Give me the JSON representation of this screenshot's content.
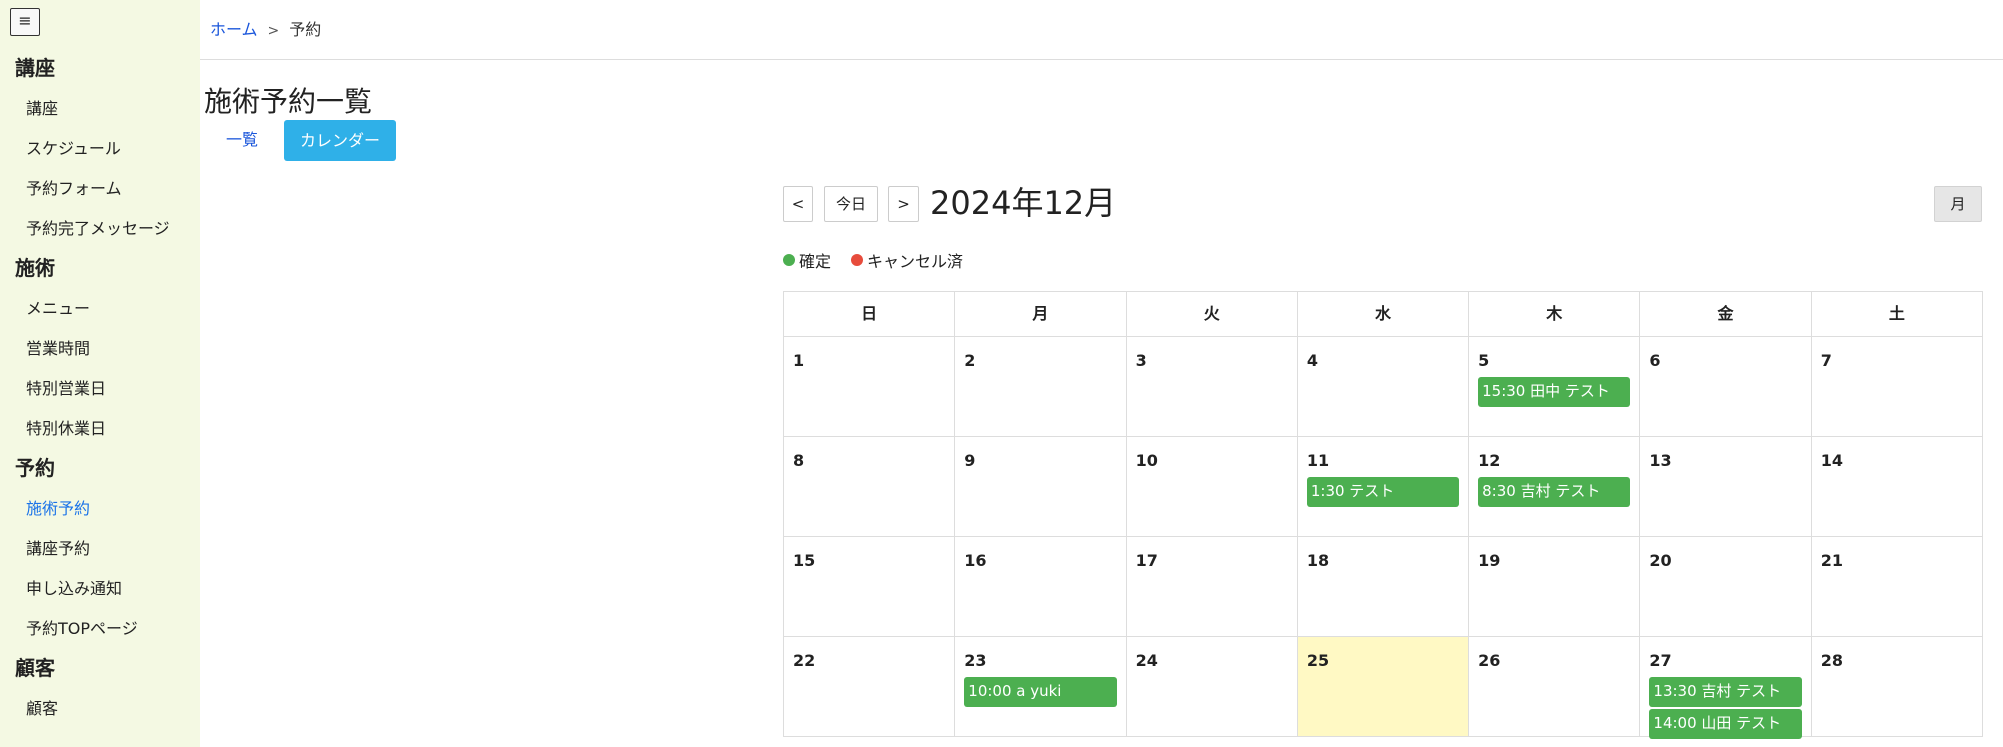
{
  "menu_toggle": "≡",
  "sidebar": {
    "groups": [
      {
        "label": "講座",
        "items": [
          "講座",
          "スケジュール",
          "予約フォーム",
          "予約完了メッセージ"
        ]
      },
      {
        "label": "施術",
        "items": [
          "メニュー",
          "営業時間",
          "特別営業日",
          "特別休業日"
        ]
      },
      {
        "label": "予約",
        "items": [
          "施術予約",
          "講座予約",
          "申し込み通知",
          "予約TOPページ"
        ]
      },
      {
        "label": "顧客",
        "items": [
          "顧客"
        ]
      }
    ],
    "active_item": "施術予約"
  },
  "breadcrumb": {
    "home": "ホーム",
    "separator": ">",
    "current": "予約"
  },
  "page_title": "施術予約一覧",
  "tabs": {
    "list": "一覧",
    "calendar": "カレンダー"
  },
  "calendar": {
    "prev": "<",
    "today": "今日",
    "next": ">",
    "title": "2024年12月",
    "view_month": "月",
    "legend": [
      {
        "label": "確定",
        "color": "#4caf50"
      },
      {
        "label": "キャンセル済",
        "color": "#e74c3c"
      }
    ],
    "weekdays": [
      "日",
      "月",
      "火",
      "水",
      "木",
      "金",
      "土"
    ],
    "today_date": 25,
    "weeks": [
      [
        {
          "day": "1",
          "events": []
        },
        {
          "day": "2",
          "events": []
        },
        {
          "day": "3",
          "events": []
        },
        {
          "day": "4",
          "events": []
        },
        {
          "day": "5",
          "events": [
            "15:30 田中 テスト"
          ]
        },
        {
          "day": "6",
          "events": []
        },
        {
          "day": "7",
          "events": []
        }
      ],
      [
        {
          "day": "8",
          "events": []
        },
        {
          "day": "9",
          "events": []
        },
        {
          "day": "10",
          "events": []
        },
        {
          "day": "11",
          "events": [
            "1:30 テスト"
          ]
        },
        {
          "day": "12",
          "events": [
            "8:30 吉村 テスト"
          ]
        },
        {
          "day": "13",
          "events": []
        },
        {
          "day": "14",
          "events": []
        }
      ],
      [
        {
          "day": "15",
          "events": []
        },
        {
          "day": "16",
          "events": []
        },
        {
          "day": "17",
          "events": []
        },
        {
          "day": "18",
          "events": []
        },
        {
          "day": "19",
          "events": []
        },
        {
          "day": "20",
          "events": []
        },
        {
          "day": "21",
          "events": []
        }
      ],
      [
        {
          "day": "22",
          "events": []
        },
        {
          "day": "23",
          "events": [
            "10:00 a yuki"
          ]
        },
        {
          "day": "24",
          "events": []
        },
        {
          "day": "25",
          "events": []
        },
        {
          "day": "26",
          "events": []
        },
        {
          "day": "27",
          "events": [
            "13:30 吉村 テスト",
            "14:00 山田 テスト"
          ]
        },
        {
          "day": "28",
          "events": []
        }
      ]
    ],
    "event_color": "#4caf50"
  }
}
